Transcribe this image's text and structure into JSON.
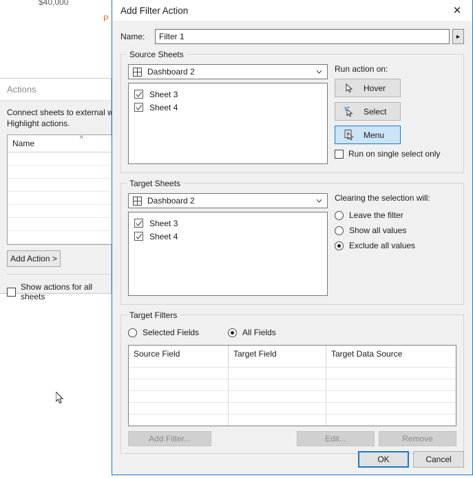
{
  "background": {
    "axis_value": "$40,000",
    "orange_label": "P",
    "actions_panel": {
      "title": "Actions",
      "description": "Connect sheets to external we actions and Highlight actions.",
      "list_header": "Name",
      "add_action_label": "Add Action >",
      "show_all_label": "Show actions for all sheets",
      "show_all_checked": false,
      "sort_caret_icon": "sort-ascending-caret-icon"
    }
  },
  "dialog": {
    "title": "Add Filter Action",
    "close_icon": "close-icon",
    "name": {
      "label": "Name:",
      "value": "Filter 1",
      "placeholder": "",
      "arrow_icon": "triangle-right-icon"
    },
    "source_sheets": {
      "title": "Source Sheets",
      "dropdown_icon": "dashboard-grid-icon",
      "dropdown_value": "Dashboard 2",
      "caret_icon": "chevron-down-icon",
      "sheets": [
        {
          "label": "Sheet 3",
          "checked": true
        },
        {
          "label": "Sheet 4",
          "checked": true
        }
      ],
      "run_action_on_label": "Run action on:",
      "run_buttons": [
        {
          "label": "Hover",
          "icon": "cursor-hover-icon",
          "selected": false
        },
        {
          "label": "Select",
          "icon": "cursor-select-icon",
          "selected": false
        },
        {
          "label": "Menu",
          "icon": "cursor-menu-icon",
          "selected": true
        }
      ],
      "single_select_label": "Run on single select only",
      "single_select_checked": false
    },
    "target_sheets": {
      "title": "Target Sheets",
      "dropdown_icon": "dashboard-grid-icon",
      "dropdown_value": "Dashboard 2",
      "caret_icon": "chevron-down-icon",
      "sheets": [
        {
          "label": "Sheet 3",
          "checked": true
        },
        {
          "label": "Sheet 4",
          "checked": true
        }
      ],
      "clearing_label": "Clearing the selection will:",
      "clearing_options": [
        {
          "label": "Leave the filter",
          "selected": false
        },
        {
          "label": "Show all values",
          "selected": false
        },
        {
          "label": "Exclude all values",
          "selected": true
        }
      ]
    },
    "target_filters": {
      "title": "Target Filters",
      "scope_options": [
        {
          "label": "Selected Fields",
          "selected": false
        },
        {
          "label": "All Fields",
          "selected": true
        }
      ],
      "columns": [
        "Source Field",
        "Target Field",
        "Target Data Source"
      ],
      "rows": [],
      "empty_row_count": 5,
      "buttons": [
        {
          "label": "Add Filter...",
          "enabled": false
        },
        {
          "label": "Edit...",
          "enabled": false
        },
        {
          "label": "Remove",
          "enabled": false
        }
      ]
    },
    "footer": {
      "ok_label": "OK",
      "cancel_label": "Cancel"
    }
  },
  "colors": {
    "accent": "#1b78c8",
    "selected_button_bg": "#cce4f7",
    "dialog_bg": "#f0f0f0",
    "orange": "#d2731d"
  }
}
